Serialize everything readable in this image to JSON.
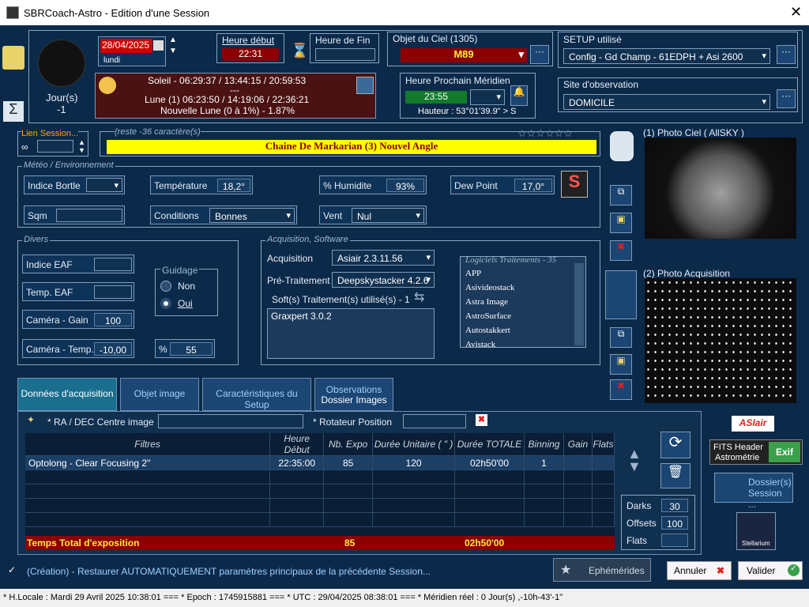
{
  "window": {
    "title": "SBRCoach-Astro - Edition d'une Session"
  },
  "session": {
    "date": "28/04/2025",
    "weekday": "lundi",
    "days_label": "Jour(s)",
    "days_value": "-1",
    "heure_debut_label": "Heure début",
    "heure_debut": "22:31",
    "heure_fin_label": "Heure de Fin",
    "heure_fin": "",
    "objet_label": "Objet du Ciel (1305)",
    "objet": "M89",
    "meridien_label": "Heure Prochain Méridien",
    "meridien": "23:55",
    "hauteur": "Hauteur : 53°01'39.9\" > S",
    "setup_label": "SETUP utilisé",
    "setup": "Config - Gd Champ - 61EDPH + Asi 2600",
    "site_label": "Site d'observation",
    "site": "DOMICILE"
  },
  "ephem": {
    "soleil": "Soleil - 06:29:37 / 13:44:15 / 20:59:53",
    "sep": "---",
    "lune": "Lune (1) 06:23:50 / 14:19:06 / 22:36:21",
    "nouvelle": "Nouvelle Lune (0 à 1%) - 1.87%"
  },
  "lien": {
    "label": "Lien Session...",
    "reste": "(reste -36 caractère(s)",
    "title": "Chaine De Markarian (3) Nouvel Angle"
  },
  "meteo": {
    "section": "Météo / Environnement",
    "bortle_label": "Indice Bortle",
    "bortle": "",
    "temp_label": "Température",
    "temp": "18,2°",
    "hum_label": "% Humidite",
    "hum": "93%",
    "dew_label": "Dew Point",
    "dew": "17,0°",
    "sqm_label": "Sqm",
    "sqm": "",
    "cond_label": "Conditions",
    "cond": "Bonnes",
    "vent_label": "Vent",
    "vent": "Nul"
  },
  "divers": {
    "section": "Divers",
    "eaf_label": "Indice EAF",
    "eaf": "",
    "teaf_label": "Temp. EAF",
    "teaf": "",
    "gain_label": "Caméra - Gain",
    "gain": "100",
    "ctemp_label": "Caméra - Temp.",
    "ctemp": "-10,00",
    "guidage": "Guidage",
    "non": "Non",
    "oui": "Oui",
    "pct_label": "%",
    "pct": "55"
  },
  "acq": {
    "section": "Acquisition, Software",
    "acq_label": "Acquisition",
    "acq": "Asiair 2.3.11.56",
    "pre_label": "Pré-Traitement",
    "pre": "Deepskystacker 4.2.6",
    "soft_label": "Soft(s) Traitement(s) utilisé(s) - 1",
    "soft": "Graxpert 3.0.2",
    "logiciels_label": "Logiciels Traitements - 35",
    "logiciels": [
      "APP",
      "Asivideostack",
      "Astra Image",
      "AstroSurface",
      "Autostakkert",
      "Avistack"
    ]
  },
  "photos": {
    "ciel": "(1) Photo Ciel ( AllSKY )",
    "acq": "(2) Photo Acquisition"
  },
  "tabs": [
    "Données d'acquisition",
    "Objet image",
    "Caractéristiques du Setup",
    "Observations",
    "Dossier Images"
  ],
  "ra": {
    "label": "* RA / DEC Centre image",
    "rot": "* Rotateur Position"
  },
  "table": {
    "headers": [
      "Filtres",
      "Heure Début",
      "Nb. Expo",
      "Durée Unitaire ( \" )",
      "Durée TOTALE",
      "Binning",
      "Gain",
      "Flats"
    ],
    "rows": [
      [
        "Optolong - Clear Focusing 2\"",
        "22:35:00",
        "85",
        "120",
        "02h50'00",
        "1",
        "",
        ""
      ]
    ],
    "total_label": "Temps Total d'exposition",
    "total_expo": "85",
    "total_duree": "02h50'00"
  },
  "counts": {
    "darks_label": "Darks",
    "darks": "30",
    "offsets_label": "Offsets",
    "offsets": "100",
    "flats_label": "Flats",
    "flats": ""
  },
  "side": {
    "asiair": "ASIair",
    "fits": "FITS Header",
    "astro": "Astrométrie",
    "exif": "Exif",
    "dossier": "Dossier(s)",
    "session": "Session ...",
    "stellarium": "Stellarium"
  },
  "bottom": {
    "restore": "(Création) - Restaurer AUTOMATIQUEMENT paramètres principaux de la précédente Session...",
    "ephem": "Ephémérides",
    "annuler": "Annuler",
    "valider": "Valider"
  },
  "status": "* H.Locale : Mardi 29 Avril 2025 10:38:01  ===  * Epoch : 1745915881  ===  * UTC : 29/04/2025 08:38:01  ===  * Méridien réel : 0 Jour(s) ,-10h-43'-1\"",
  "colors": {
    "bg": "#0b2a4a",
    "accent": "#ffff00",
    "red": "#8b0000"
  }
}
